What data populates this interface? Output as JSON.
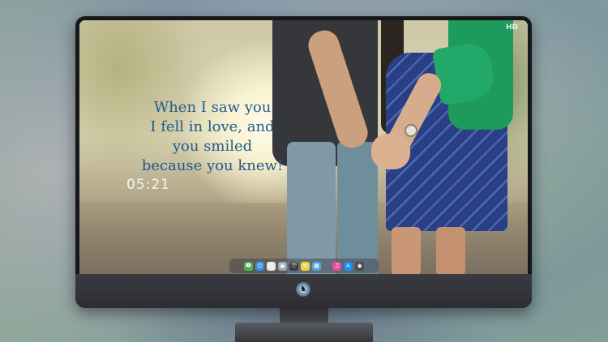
{
  "wallpaper": {
    "quote_lines": [
      "When I saw you",
      "I fell in love, and",
      "you smiled",
      "because you knew!"
    ],
    "clock": "05:21",
    "watermark": "HD"
  },
  "dock": {
    "apps": [
      {
        "name": "messages",
        "glyph": "💬",
        "color": "#3ec24a"
      },
      {
        "name": "finder",
        "glyph": "☺",
        "color": "#2f8fe8"
      },
      {
        "name": "clock",
        "glyph": "◷",
        "color": "#e9e9e9"
      },
      {
        "name": "preview",
        "glyph": "▣",
        "color": "#9aa8b6"
      },
      {
        "name": "video",
        "glyph": "🎬",
        "color": "#3b3b3b"
      },
      {
        "name": "notes",
        "glyph": "≡",
        "color": "#f3d23f"
      },
      {
        "name": "photos",
        "glyph": "▦",
        "color": "#54a4e0"
      },
      {
        "name": "itunes",
        "glyph": "♫",
        "color": "#e94aa1"
      },
      {
        "name": "app-store",
        "glyph": "A",
        "color": "#1d8df0"
      },
      {
        "name": "camera",
        "glyph": "◉",
        "color": "#4a4a4a"
      }
    ]
  }
}
